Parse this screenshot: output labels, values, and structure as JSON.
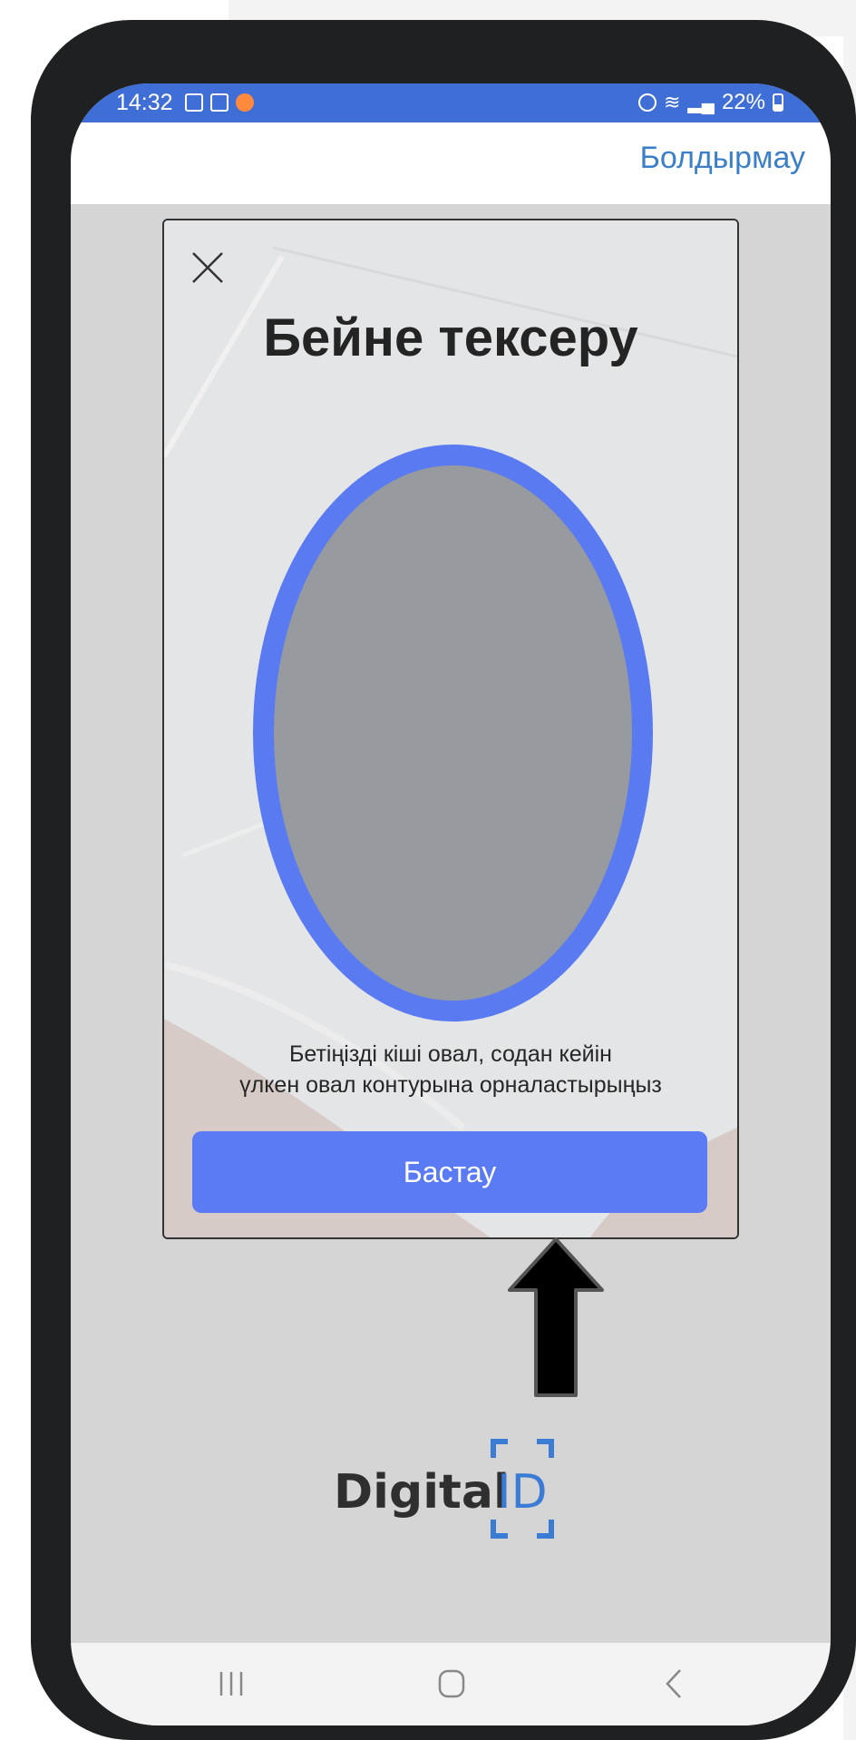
{
  "status_bar": {
    "time": "14:32",
    "battery": "22%"
  },
  "header": {
    "cancel_label": "Болдырмау"
  },
  "modal": {
    "title": "Бейне тексеру",
    "instruction_line1": "Бетіңізді кіші овал, содан кейін",
    "instruction_line2": "үлкен овал контурына орналастырыңыз",
    "start_label": "Бастау"
  },
  "brand": {
    "text": "Digital",
    "id": "ID"
  },
  "colors": {
    "accent": "#5b7bf4",
    "status_bar": "#3f6fd6",
    "link": "#3a7fc8"
  },
  "icons": {
    "close": "close-icon",
    "arrow": "arrow-up-icon",
    "nav_recent": "recent-apps-icon",
    "nav_home": "home-icon",
    "nav_back": "back-icon"
  }
}
